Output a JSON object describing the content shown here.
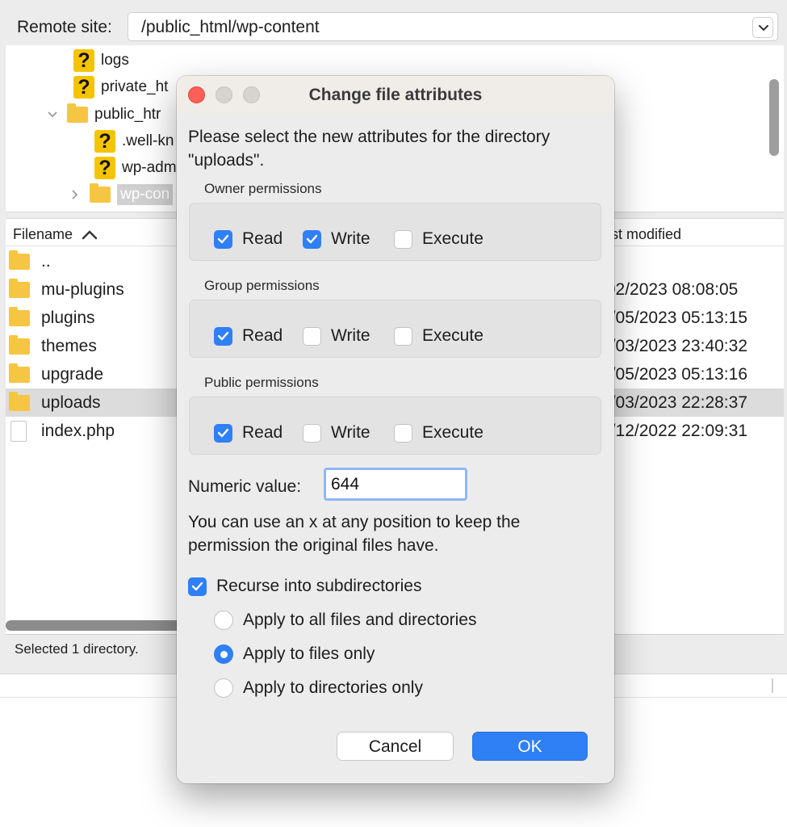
{
  "remote_site": {
    "label": "Remote site:",
    "path": "/public_html/wp-content"
  },
  "tree": {
    "items": [
      {
        "name": "logs",
        "icon": "question-icon"
      },
      {
        "name": "private_ht",
        "icon": "question-icon"
      },
      {
        "name": "public_htr",
        "icon": "folder-icon",
        "expanded": true
      },
      {
        "name": ".well-kn",
        "icon": "question-icon"
      },
      {
        "name": "wp-adm",
        "icon": "question-icon"
      },
      {
        "name": "wp-con",
        "icon": "folder-icon",
        "selected": true
      }
    ]
  },
  "file_list": {
    "col_filename": "Filename",
    "col_modified": "ast modified",
    "rows": [
      {
        "name": "..",
        "type": "folder",
        "date": ""
      },
      {
        "name": "mu-plugins",
        "type": "folder",
        "date": "/02/2023 08:08:05"
      },
      {
        "name": "plugins",
        "type": "folder",
        "date": "5/05/2023 05:13:15"
      },
      {
        "name": "themes",
        "type": "folder",
        "date": "9/03/2023 23:40:32"
      },
      {
        "name": "upgrade",
        "type": "folder",
        "date": "5/05/2023 05:13:16"
      },
      {
        "name": "uploads",
        "type": "folder",
        "date": "5/03/2023 22:28:37",
        "selected": true
      },
      {
        "name": "index.php",
        "type": "file",
        "date": "7/12/2022 22:09:31"
      }
    ]
  },
  "status": {
    "text": "Selected 1 directory."
  },
  "dialog": {
    "title": "Change file attributes",
    "intro_line1": "Please select the new attributes for the directory",
    "intro_line2": "\"uploads\".",
    "owner": {
      "label": "Owner permissions",
      "read": "Read",
      "write": "Write",
      "execute": "Execute",
      "read_checked": true,
      "write_checked": true,
      "execute_checked": false
    },
    "group": {
      "label": "Group permissions",
      "read": "Read",
      "write": "Write",
      "execute": "Execute",
      "read_checked": true,
      "write_checked": false,
      "execute_checked": false
    },
    "public": {
      "label": "Public permissions",
      "read": "Read",
      "write": "Write",
      "execute": "Execute",
      "read_checked": true,
      "write_checked": false,
      "execute_checked": false
    },
    "numeric_label": "Numeric value:",
    "numeric_value": "644",
    "hint_line1": "You can use an x at any position to keep the",
    "hint_line2": "permission the original files have.",
    "recurse_label": "Recurse into subdirectories",
    "recurse_checked": true,
    "apply_all": "Apply to all files and directories",
    "apply_files": "Apply to files only",
    "apply_dirs": "Apply to directories only",
    "selected_apply": "files",
    "cancel": "Cancel",
    "ok": "OK"
  },
  "colors": {
    "accent": "#2f7ff5",
    "close": "#fe5f57",
    "folder": "#f6c544",
    "unknown": "#f5c400"
  }
}
